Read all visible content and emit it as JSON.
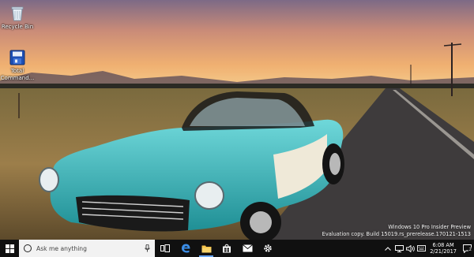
{
  "desktop": {
    "icons": [
      {
        "label": "Recycle Bin",
        "icon": "recycle-bin-icon"
      },
      {
        "label": "Total Command...",
        "icon": "total-commander-icon"
      }
    ]
  },
  "watermark": {
    "line1": "Windows 10 Pro Insider Preview",
    "line2": "Evaluation copy. Build 15019.rs_prerelease.170121-1513"
  },
  "taskbar": {
    "search_placeholder": "Ask me anything",
    "apps": [
      "task-view-icon",
      "edge-icon",
      "file-explorer-icon",
      "store-icon",
      "mail-icon",
      "settings-icon"
    ],
    "clock": {
      "time": "6:08 AM",
      "date": "2/21/2017"
    },
    "notification_count": "2",
    "accent_color": "#6aa7ff"
  }
}
